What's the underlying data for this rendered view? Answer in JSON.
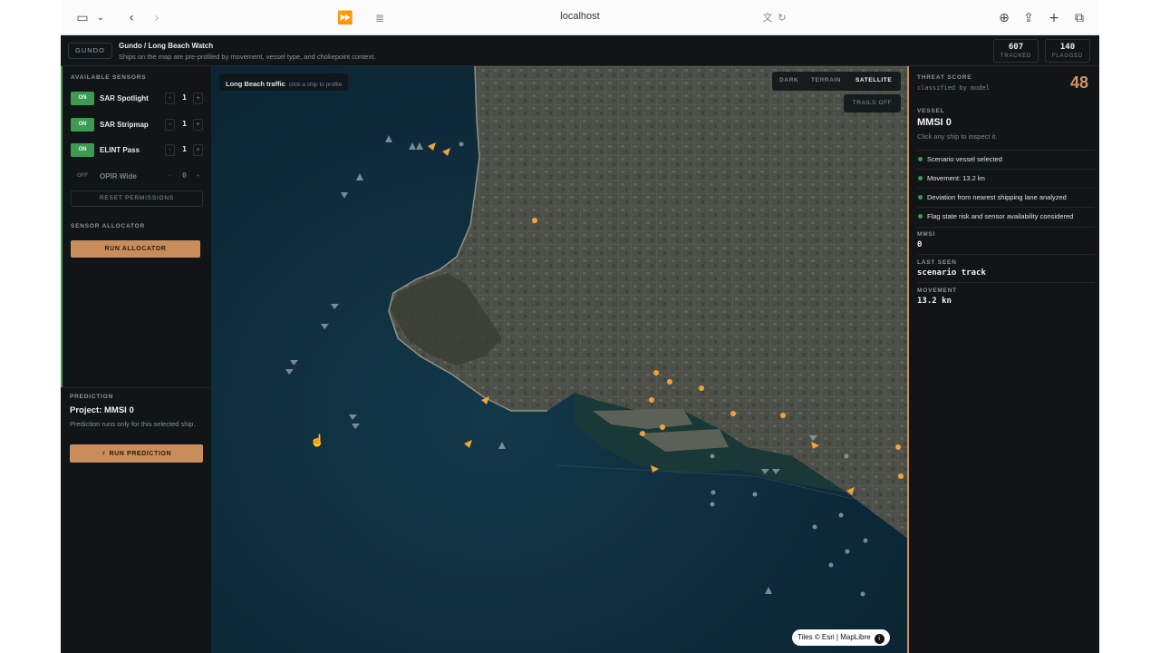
{
  "browser": {
    "url": "localhost",
    "icons": [
      "sidebar-icon",
      "chevron-down-icon",
      "back-icon",
      "forward-icon",
      "fast-forward-icon",
      "reader-icon",
      "translate-icon",
      "reload-icon",
      "download-icon",
      "share-icon",
      "new-tab-icon",
      "tabs-icon"
    ]
  },
  "header": {
    "brand": "GUNDO",
    "title": "Gundo / Long Beach Watch",
    "subtitle": "Ships on the map are pre-profiled by movement, vessel type, and chokepoint context.",
    "stats": [
      {
        "value": "607",
        "label": "TRACKED"
      },
      {
        "value": "140",
        "label": "FLAGGED"
      }
    ]
  },
  "sensors": {
    "section_label": "AVAILABLE SENSORS",
    "items": [
      {
        "toggle": "ON",
        "name": "SAR Spotlight",
        "count": "1",
        "minus": "-",
        "plus": "+"
      },
      {
        "toggle": "ON",
        "name": "SAR Stripmap",
        "count": "1",
        "minus": "-",
        "plus": "+"
      },
      {
        "toggle": "ON",
        "name": "ELINT Pass",
        "count": "1",
        "minus": "-",
        "plus": "+"
      },
      {
        "toggle": "OFF",
        "name": "OPIR Wide",
        "count": "0",
        "minus": "-",
        "plus": "+"
      }
    ],
    "reset_label": "RESET PERMISSIONS",
    "allocator_label": "SENSOR ALLOCATOR",
    "run_allocator": "RUN ALLOCATOR"
  },
  "prediction": {
    "section_label": "PREDICTION",
    "title": "Project: MMSI 0",
    "subtitle": "Prediction runs only for this selected ship.",
    "button": "RUN PREDICTION"
  },
  "map": {
    "chip_title": "Long Beach traffic",
    "chip_hint": "click a ship to profile",
    "modes": [
      "DARK",
      "TERRAIN",
      "SATELLITE"
    ],
    "active_mode": "SATELLITE",
    "trails": "TRAILS OFF",
    "attribution": "Tiles © Esri | MapLibre",
    "attribution_info": "i",
    "colors": {
      "flagged": "#f0a33a",
      "vessel": "#8e9aa1",
      "water": "#0f2c3a",
      "land": "#4a4f45"
    }
  },
  "details": {
    "score_label": "THREAT SCORE",
    "score_sub": "classified by model",
    "score": "48",
    "vessel_label": "VESSEL",
    "vessel_name": "MMSI 0",
    "vessel_hint": "Click any ship to inspect it.",
    "facts": [
      "Scenario vessel selected",
      "Movement: 13.2 kn",
      "Deviation from nearest shipping lane analyzed",
      "Flag state risk and sensor availability considered"
    ],
    "fields": [
      {
        "label": "MMSI",
        "value": "0"
      },
      {
        "label": "LAST SEEN",
        "value": "scenario track"
      },
      {
        "label": "MOVEMENT",
        "value": "13.2 kn"
      }
    ]
  }
}
